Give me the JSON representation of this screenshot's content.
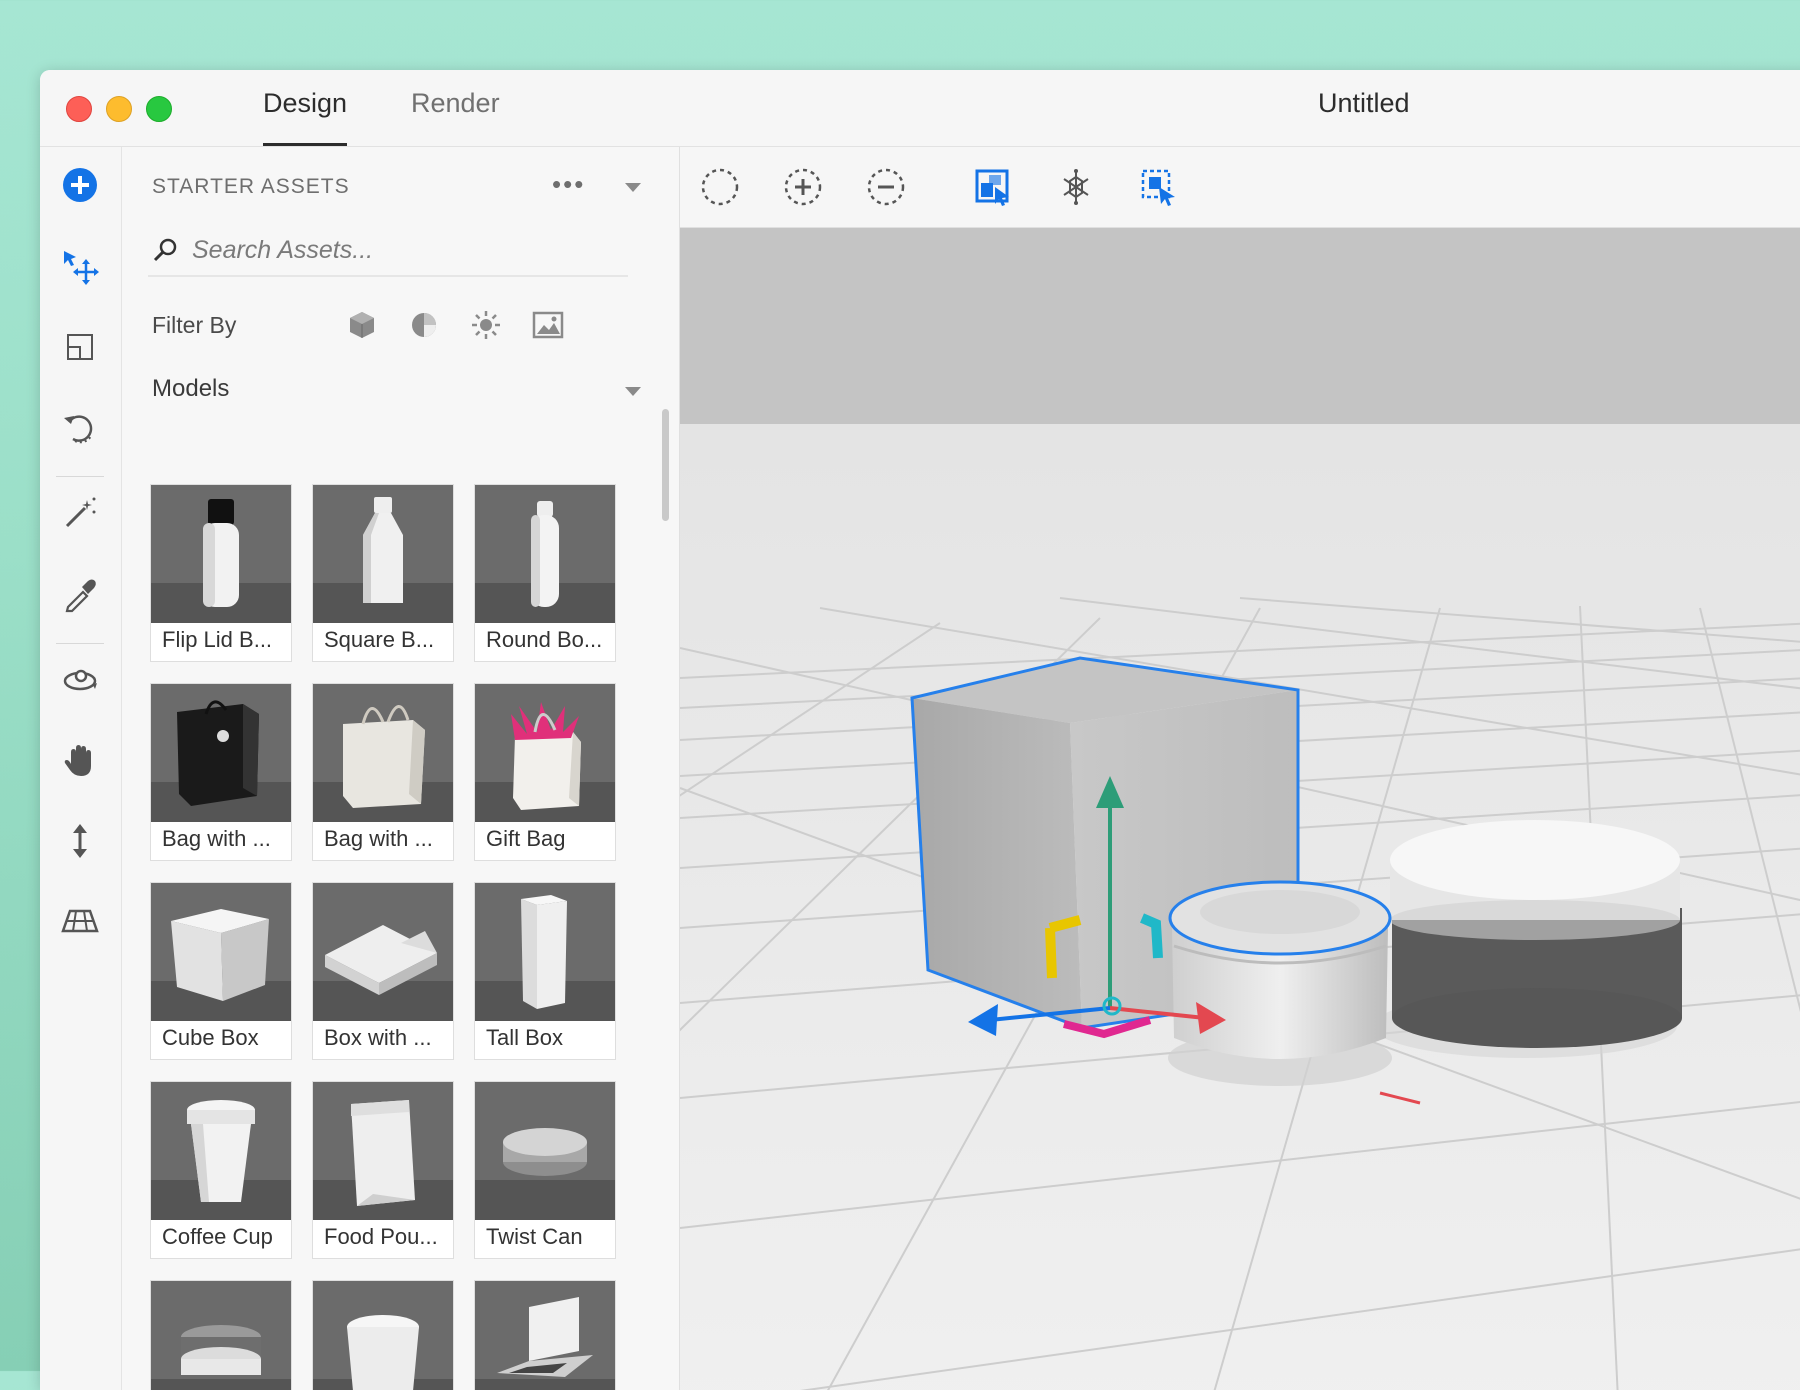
{
  "window": {
    "tabs": [
      {
        "label": "Design",
        "active": true
      },
      {
        "label": "Render",
        "active": false
      }
    ],
    "title": "Untitled"
  },
  "tool_rail": {
    "tools": [
      "add-icon",
      "select-move-icon",
      "layout-icon",
      "rotate-icon",
      "magic-wand-icon",
      "eyedropper-icon",
      "orbit-icon",
      "pan-hand-icon",
      "dolly-icon",
      "ground-plane-icon"
    ]
  },
  "panel": {
    "title": "STARTER ASSETS",
    "more_label": "•••",
    "search": {
      "placeholder": "Search Assets..."
    },
    "filter": {
      "label": "Filter By",
      "options": [
        "models-filter-icon",
        "materials-filter-icon",
        "lights-filter-icon",
        "images-filter-icon"
      ]
    },
    "section": "Models",
    "assets": [
      {
        "label": "Flip Lid B...",
        "icon": "flip-lid-bottle"
      },
      {
        "label": "Square B...",
        "icon": "square-bottle"
      },
      {
        "label": "Round Bo...",
        "icon": "round-bottle"
      },
      {
        "label": "Bag with ...",
        "icon": "black-bag"
      },
      {
        "label": "Bag with ...",
        "icon": "white-bag"
      },
      {
        "label": "Gift Bag",
        "icon": "gift-bag"
      },
      {
        "label": "Cube Box",
        "icon": "cube-box"
      },
      {
        "label": "Box with ...",
        "icon": "box-with-lid"
      },
      {
        "label": "Tall Box",
        "icon": "tall-box"
      },
      {
        "label": "Coffee Cup",
        "icon": "coffee-cup"
      },
      {
        "label": "Food Pou...",
        "icon": "food-pouch"
      },
      {
        "label": "Twist Can",
        "icon": "twist-can"
      },
      {
        "label": "",
        "icon": "jar"
      },
      {
        "label": "",
        "icon": "cream-tub"
      },
      {
        "label": "",
        "icon": "laptop"
      }
    ]
  },
  "viewport_toolbar": {
    "tools": [
      "select-icon",
      "add-to-selection-icon",
      "subtract-selection-icon",
      "select-object-icon",
      "select-similar-icon",
      "select-group-icon"
    ]
  },
  "colors": {
    "accent": "#1473e6",
    "gizmo_x": "#e34850",
    "gizmo_y": "#2d9d78",
    "gizmo_z": "#1473e6",
    "gizmo_plane_xy": "#e8c600",
    "gizmo_plane_yz": "#20b8c8",
    "gizmo_plane_xz": "#e02890"
  }
}
